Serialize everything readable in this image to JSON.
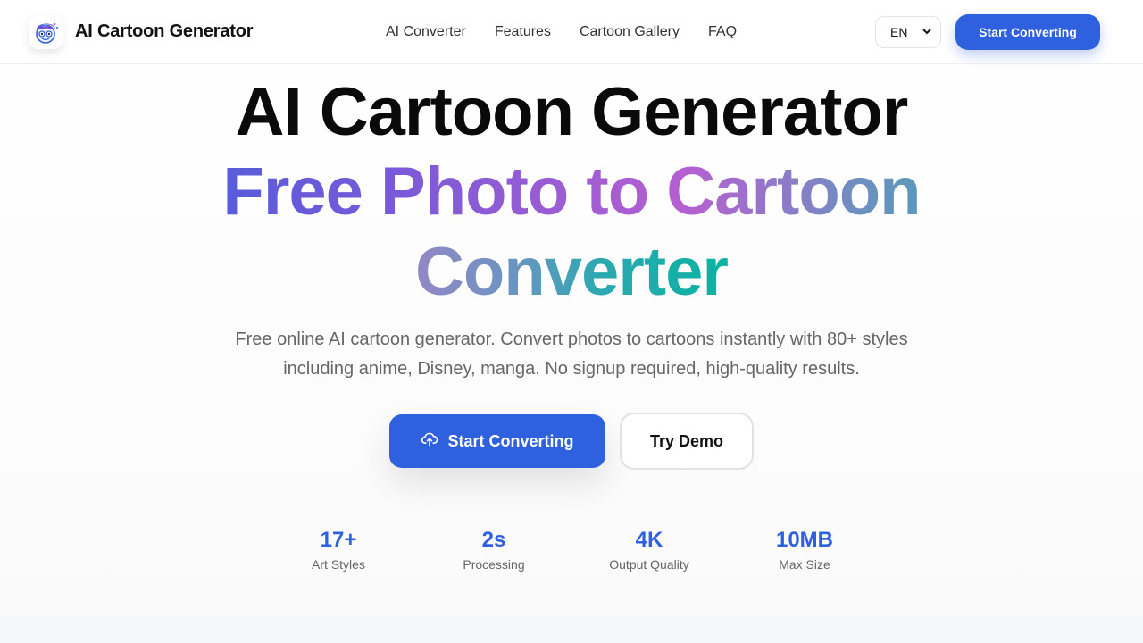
{
  "header": {
    "brand": "AI Cartoon Generator",
    "logo_icon": "cartoon-face-icon",
    "nav": [
      "AI Converter",
      "Features",
      "Cartoon Gallery",
      "FAQ"
    ],
    "language": "EN",
    "cta": "Start Converting"
  },
  "hero": {
    "title_line1": "AI Cartoon Generator",
    "title_line2": "Free Photo to Cartoon",
    "title_line3": "Converter",
    "subtitle": "Free online AI cartoon generator. Convert photos to cartoons instantly with 80+ styles including anime, Disney, manga. No signup required, high-quality results.",
    "primary_cta": "Start Converting",
    "primary_cta_icon": "upload-cloud-icon",
    "secondary_cta": "Try Demo"
  },
  "stats": [
    {
      "value": "17+",
      "label": "Art Styles"
    },
    {
      "value": "2s",
      "label": "Processing"
    },
    {
      "value": "4K",
      "label": "Output Quality"
    },
    {
      "value": "10MB",
      "label": "Max Size"
    }
  ],
  "colors": {
    "accent": "#2f60dd",
    "gradient_start": "#2e5ee0",
    "gradient_end": "#08b3a0"
  }
}
